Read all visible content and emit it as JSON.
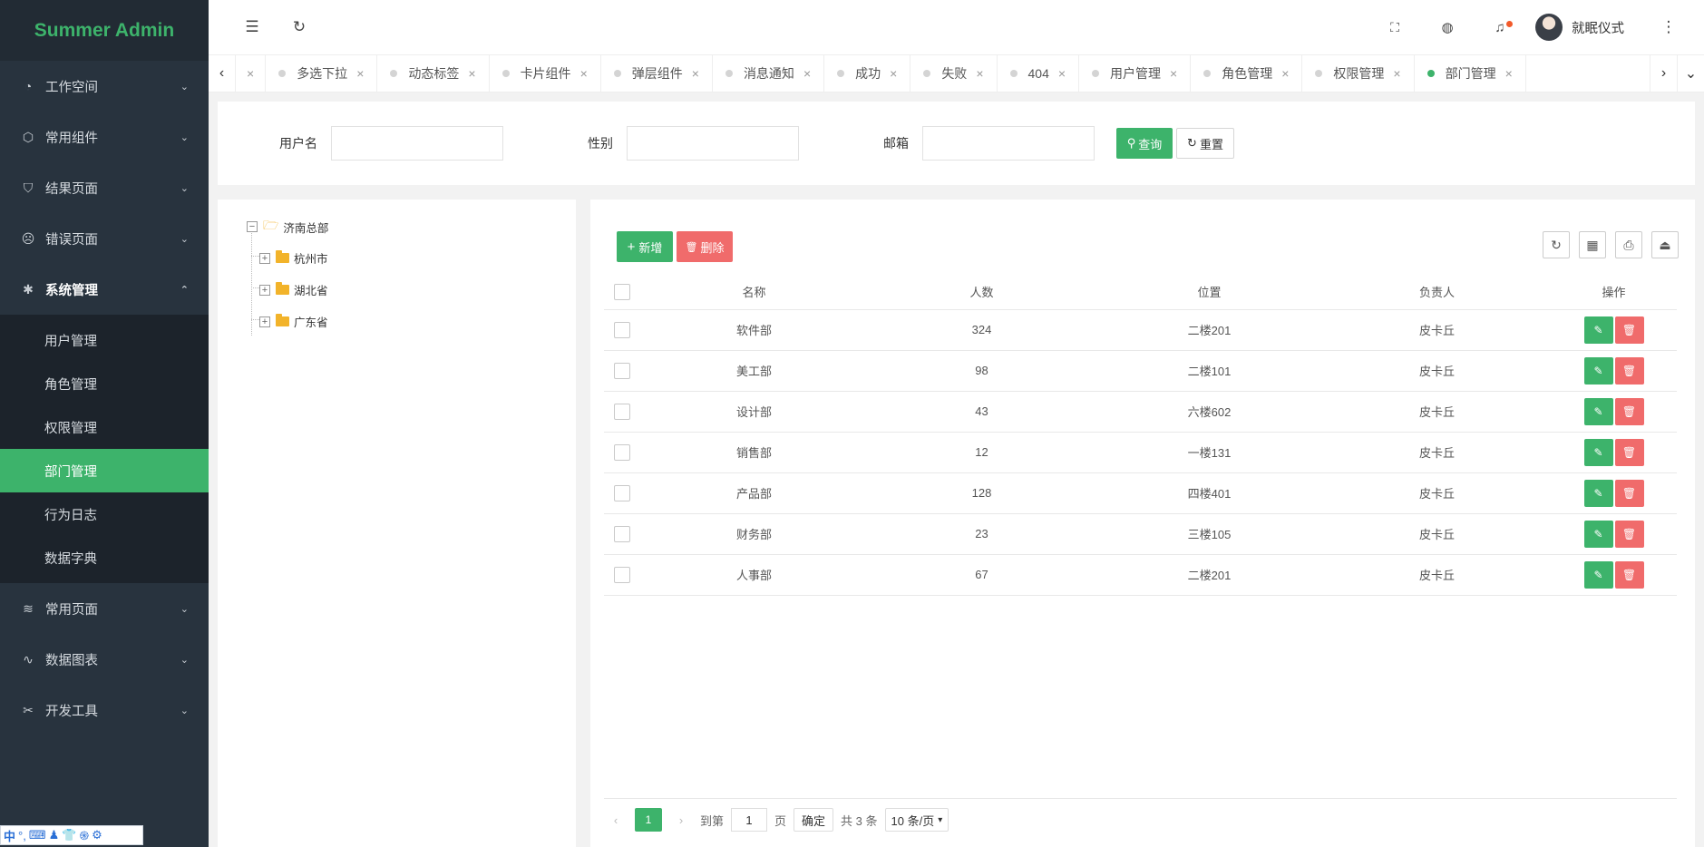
{
  "app": {
    "title": "Summer Admin",
    "brand_color": "#3db36b",
    "danger_color": "#f06b6b"
  },
  "sidebar": {
    "items": [
      {
        "label": "工作空间",
        "icon": "dashboard-icon",
        "expanded": false
      },
      {
        "label": "常用组件",
        "icon": "cube-icon",
        "expanded": false
      },
      {
        "label": "结果页面",
        "icon": "shield-check-icon",
        "expanded": false
      },
      {
        "label": "错误页面",
        "icon": "sad-face-icon",
        "expanded": false
      },
      {
        "label": "系统管理",
        "icon": "gear-icon",
        "expanded": true
      },
      {
        "label": "常用页面",
        "icon": "layers-icon",
        "expanded": false
      },
      {
        "label": "数据图表",
        "icon": "pulse-icon",
        "expanded": false
      },
      {
        "label": "开发工具",
        "icon": "tools-icon",
        "expanded": false
      }
    ],
    "submenu": [
      {
        "label": "用户管理",
        "active": false
      },
      {
        "label": "角色管理",
        "active": false
      },
      {
        "label": "权限管理",
        "active": false
      },
      {
        "label": "部门管理",
        "active": true
      },
      {
        "label": "行为日志",
        "active": false
      },
      {
        "label": "数据字典",
        "active": false
      }
    ]
  },
  "header": {
    "username": "就眠仪式",
    "notification_dot": true
  },
  "tabs": [
    {
      "label": "多选下拉",
      "active": false
    },
    {
      "label": "动态标签",
      "active": false
    },
    {
      "label": "卡片组件",
      "active": false
    },
    {
      "label": "弹层组件",
      "active": false
    },
    {
      "label": "消息通知",
      "active": false
    },
    {
      "label": "成功",
      "active": false
    },
    {
      "label": "失败",
      "active": false
    },
    {
      "label": "404",
      "active": false
    },
    {
      "label": "用户管理",
      "active": false
    },
    {
      "label": "角色管理",
      "active": false
    },
    {
      "label": "权限管理",
      "active": false
    },
    {
      "label": "部门管理",
      "active": true
    }
  ],
  "search": {
    "username_label": "用户名",
    "username_value": "",
    "gender_label": "性别",
    "gender_value": "",
    "email_label": "邮箱",
    "email_value": "",
    "query_button": "查询",
    "reset_button": "重置"
  },
  "tree": {
    "root": "济南总部",
    "children": [
      "杭州市",
      "湖北省",
      "广东省"
    ]
  },
  "table": {
    "add_button": "新增",
    "delete_button": "删除",
    "columns": [
      "名称",
      "人数",
      "位置",
      "负责人",
      "操作"
    ],
    "rows": [
      {
        "name": "软件部",
        "count": "324",
        "location": "二楼201",
        "owner": "皮卡丘"
      },
      {
        "name": "美工部",
        "count": "98",
        "location": "二楼101",
        "owner": "皮卡丘"
      },
      {
        "name": "设计部",
        "count": "43",
        "location": "六楼602",
        "owner": "皮卡丘"
      },
      {
        "name": "销售部",
        "count": "12",
        "location": "一楼131",
        "owner": "皮卡丘"
      },
      {
        "name": "产品部",
        "count": "128",
        "location": "四楼401",
        "owner": "皮卡丘"
      },
      {
        "name": "财务部",
        "count": "23",
        "location": "三楼105",
        "owner": "皮卡丘"
      },
      {
        "name": "人事部",
        "count": "67",
        "location": "二楼201",
        "owner": "皮卡丘"
      }
    ]
  },
  "pager": {
    "current_page": "1",
    "goto_label": "到第",
    "goto_value": "1",
    "page_unit": "页",
    "confirm": "确定",
    "total": "共 3 条",
    "page_size": "10 条/页"
  },
  "ime": {
    "label": "中"
  }
}
